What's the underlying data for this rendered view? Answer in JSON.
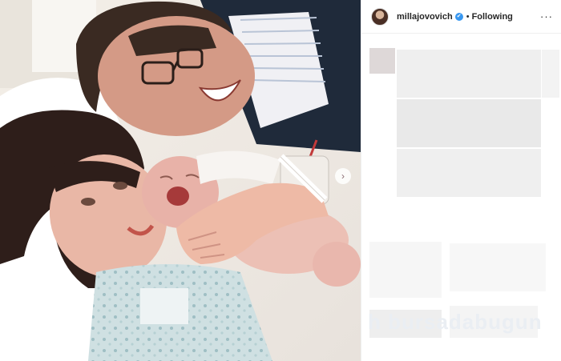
{
  "post": {
    "username": "millajovovich",
    "separator": "•",
    "follow_status": "Following",
    "more_label": "···",
    "verified_mark": "✔",
    "pager_label": "›",
    "watermark": "h bursadabugun"
  },
  "icons": {
    "avatar": "profile-avatar",
    "verified": "verified-badge",
    "more": "more-options-icon",
    "pager": "chevron-right-icon"
  },
  "colors": {
    "verified_blue": "#3897f0",
    "text": "#262626",
    "divider": "#efefef"
  }
}
